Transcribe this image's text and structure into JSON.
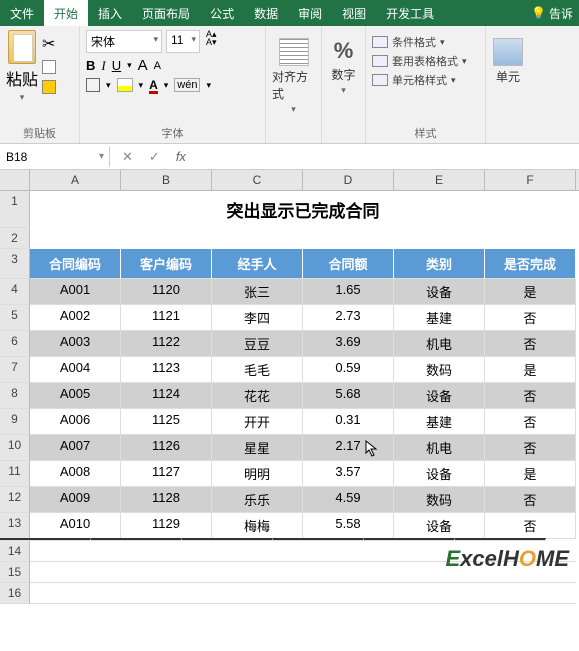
{
  "ribbon": {
    "tabs": [
      "文件",
      "开始",
      "插入",
      "页面布局",
      "公式",
      "数据",
      "审阅",
      "视图",
      "开发工具"
    ],
    "active_tab": "开始",
    "help_label": "告诉",
    "groups": {
      "clipboard": {
        "label": "剪贴板",
        "paste": "粘贴"
      },
      "font": {
        "label": "字体",
        "name": "宋体",
        "size": "11",
        "bold": "B",
        "italic": "I",
        "underline": "U",
        "wen": "wén"
      },
      "alignment": {
        "label": "对齐方式"
      },
      "number": {
        "label": "数字"
      },
      "styles": {
        "label": "样式",
        "items": [
          "条件格式",
          "套用表格格式",
          "单元格样式"
        ]
      },
      "cells": {
        "label": "单元"
      }
    }
  },
  "namebox": {
    "ref": "B18"
  },
  "formula_bar": {
    "fx": "fx"
  },
  "sheet": {
    "columns": [
      "A",
      "B",
      "C",
      "D",
      "E",
      "F"
    ],
    "title": "突出显示已完成合同",
    "headers": [
      "合同编码",
      "客户编码",
      "经手人",
      "合同额",
      "类别",
      "是否完成"
    ],
    "rows": [
      {
        "a": "A001",
        "b": "1120",
        "c": "张三",
        "d": "1.65",
        "e": "设备",
        "f": "是"
      },
      {
        "a": "A002",
        "b": "1121",
        "c": "李四",
        "d": "2.73",
        "e": "基建",
        "f": "否"
      },
      {
        "a": "A003",
        "b": "1122",
        "c": "豆豆",
        "d": "3.69",
        "e": "机电",
        "f": "否"
      },
      {
        "a": "A004",
        "b": "1123",
        "c": "毛毛",
        "d": "0.59",
        "e": "数码",
        "f": "是"
      },
      {
        "a": "A005",
        "b": "1124",
        "c": "花花",
        "d": "5.68",
        "e": "设备",
        "f": "否"
      },
      {
        "a": "A006",
        "b": "1125",
        "c": "开开",
        "d": "0.31",
        "e": "基建",
        "f": "否"
      },
      {
        "a": "A007",
        "b": "1126",
        "c": "星星",
        "d": "2.17",
        "e": "机电",
        "f": "否"
      },
      {
        "a": "A008",
        "b": "1127",
        "c": "明明",
        "d": "3.57",
        "e": "设备",
        "f": "是"
      },
      {
        "a": "A009",
        "b": "1128",
        "c": "乐乐",
        "d": "4.59",
        "e": "数码",
        "f": "否"
      },
      {
        "a": "A010",
        "b": "1129",
        "c": "梅梅",
        "d": "5.58",
        "e": "设备",
        "f": "否"
      }
    ],
    "row_nums": [
      "1",
      "2",
      "3",
      "4",
      "5",
      "6",
      "7",
      "8",
      "9",
      "10",
      "11",
      "12",
      "13",
      "14",
      "15",
      "16"
    ]
  },
  "watermark": {
    "text1": "E",
    "text2": "xcel",
    "text3": "H",
    "text4": "O",
    "text5": "ME"
  }
}
